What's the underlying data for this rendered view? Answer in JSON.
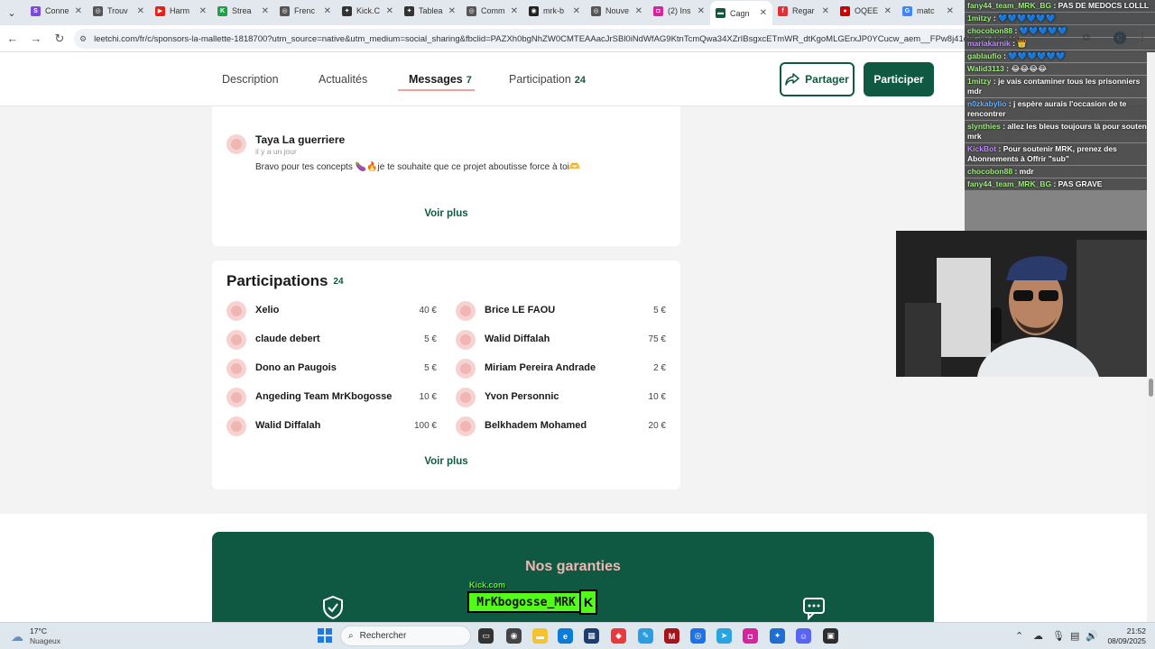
{
  "browser": {
    "tabs": [
      {
        "label": "Conne",
        "color": "#7b4bd6",
        "icon": "S"
      },
      {
        "label": "Trouv",
        "color": "#555555",
        "icon": "◎"
      },
      {
        "label": "Harm",
        "color": "#e62117",
        "icon": "▶"
      },
      {
        "label": "Strea",
        "color": "#22a045",
        "icon": "K"
      },
      {
        "label": "Frenc",
        "color": "#555555",
        "icon": "◎"
      },
      {
        "label": "Kick.C",
        "color": "#333333",
        "icon": "✦"
      },
      {
        "label": "Tablea",
        "color": "#333333",
        "icon": "✦"
      },
      {
        "label": "Comm",
        "color": "#555555",
        "icon": "◎"
      },
      {
        "label": "mrk-b",
        "color": "#222222",
        "icon": "◉"
      },
      {
        "label": "Nouve",
        "color": "#555555",
        "icon": "◎"
      },
      {
        "label": "(2) Ins",
        "color": "#d6249f",
        "icon": "◘"
      },
      {
        "label": "Cagn",
        "color": "#0f5942",
        "icon": "▬",
        "active": true
      },
      {
        "label": "Regar",
        "color": "#d33",
        "icon": "f"
      },
      {
        "label": "OQEE",
        "color": "#c00",
        "icon": "●"
      },
      {
        "label": "matc",
        "color": "#4285f4",
        "icon": "G"
      }
    ],
    "url": "leetchi.com/fr/c/sponsors-la-mallette-1818700?utm_source=native&utm_medium=social_sharing&fbclid=PAZXh0bgNhZW0CMTEAAacJrSBl0iNdWfAG9KtnTcmQwa34XZrIBsgxcETmWR_dtKgoMLGErxJP0YCucw_aem__FPw8j41o8Gxy Abkd4g",
    "profile_initial": "C"
  },
  "nav": {
    "tabs": [
      {
        "label": "Description",
        "count": ""
      },
      {
        "label": "Actualités",
        "count": ""
      },
      {
        "label": "Messages",
        "count": "7"
      },
      {
        "label": "Participation",
        "count": "24"
      }
    ],
    "share_label": "Partager",
    "participate_label": "Participer"
  },
  "message": {
    "author": "Taya La guerriere",
    "time": "il y a un jour",
    "body": "Bravo pour tes concepts 🍆🔥je te souhaite que ce projet aboutisse force à toi🫶",
    "more_label": "Voir plus"
  },
  "participations": {
    "title": "Participations",
    "count": "24",
    "left": [
      {
        "name": "Xelio",
        "amount": "40 €"
      },
      {
        "name": "claude debert",
        "amount": "5 €"
      },
      {
        "name": "Dono an Paugois",
        "amount": "5 €"
      },
      {
        "name": "Angeding Team MrKbogosse",
        "amount": "10 €"
      },
      {
        "name": "Walid Diffalah",
        "amount": "100 €"
      }
    ],
    "right": [
      {
        "name": "Brice LE FAOU",
        "amount": "5 €"
      },
      {
        "name": "Walid Diffalah",
        "amount": "75 €"
      },
      {
        "name": "Miriam Pereira Andrade",
        "amount": "2 €"
      },
      {
        "name": "Yvon Personnic",
        "amount": "10 €"
      },
      {
        "name": "Belkhadem Mohamed",
        "amount": "20 €"
      }
    ],
    "more_label": "Voir plus"
  },
  "guarantees": {
    "title": "Nos garanties"
  },
  "stream": {
    "chat": [
      {
        "user": "fany44_team_MRK_BG",
        "text": ": PAS DE MEDOCS LOLLL",
        "style": ""
      },
      {
        "user": "1mitzy",
        "text": ": 💙💙💙💙💙💙",
        "style": ""
      },
      {
        "user": "chocobon88",
        "text": ": 💙💙💙💙💙",
        "style": ""
      },
      {
        "user": "mariakarnik",
        "text": ": 👑",
        "style": "purple"
      },
      {
        "user": "gablaufio",
        "text": ": 💙💙💙💙💙💙",
        "style": ""
      },
      {
        "user": "Walid3113",
        "text": ": 😂😂😂😂",
        "style": ""
      },
      {
        "user": "1mitzy",
        "text": ": je vais contaminer tous les prisonniers mdr",
        "style": ""
      },
      {
        "user": "n0zkabylio",
        "text": ": j espère aurais l'occasion de te rencontrer",
        "style": "blue"
      },
      {
        "user": "slynthies",
        "text": ": allez les bleus toujours là pour soutenir mrk",
        "style": ""
      },
      {
        "user": "KickBot",
        "text": ": Pour soutenir MRK, prenez des Abonnements à Offrir \"sub\"",
        "style": "purple"
      },
      {
        "user": "chocobon88",
        "text": ": mdr",
        "style": ""
      },
      {
        "user": "fany44_team_MRK_BG",
        "text": ": PAS GRAVE",
        "style": ""
      }
    ],
    "kick_small": "Kick.com",
    "kick_name": "MrKbogosse_MRK",
    "kick_letter": "K"
  },
  "taskbar": {
    "temp": "17°C",
    "weather": "Nuageux",
    "search_placeholder": "Rechercher",
    "time": "21:52",
    "date": "08/09/2025"
  }
}
